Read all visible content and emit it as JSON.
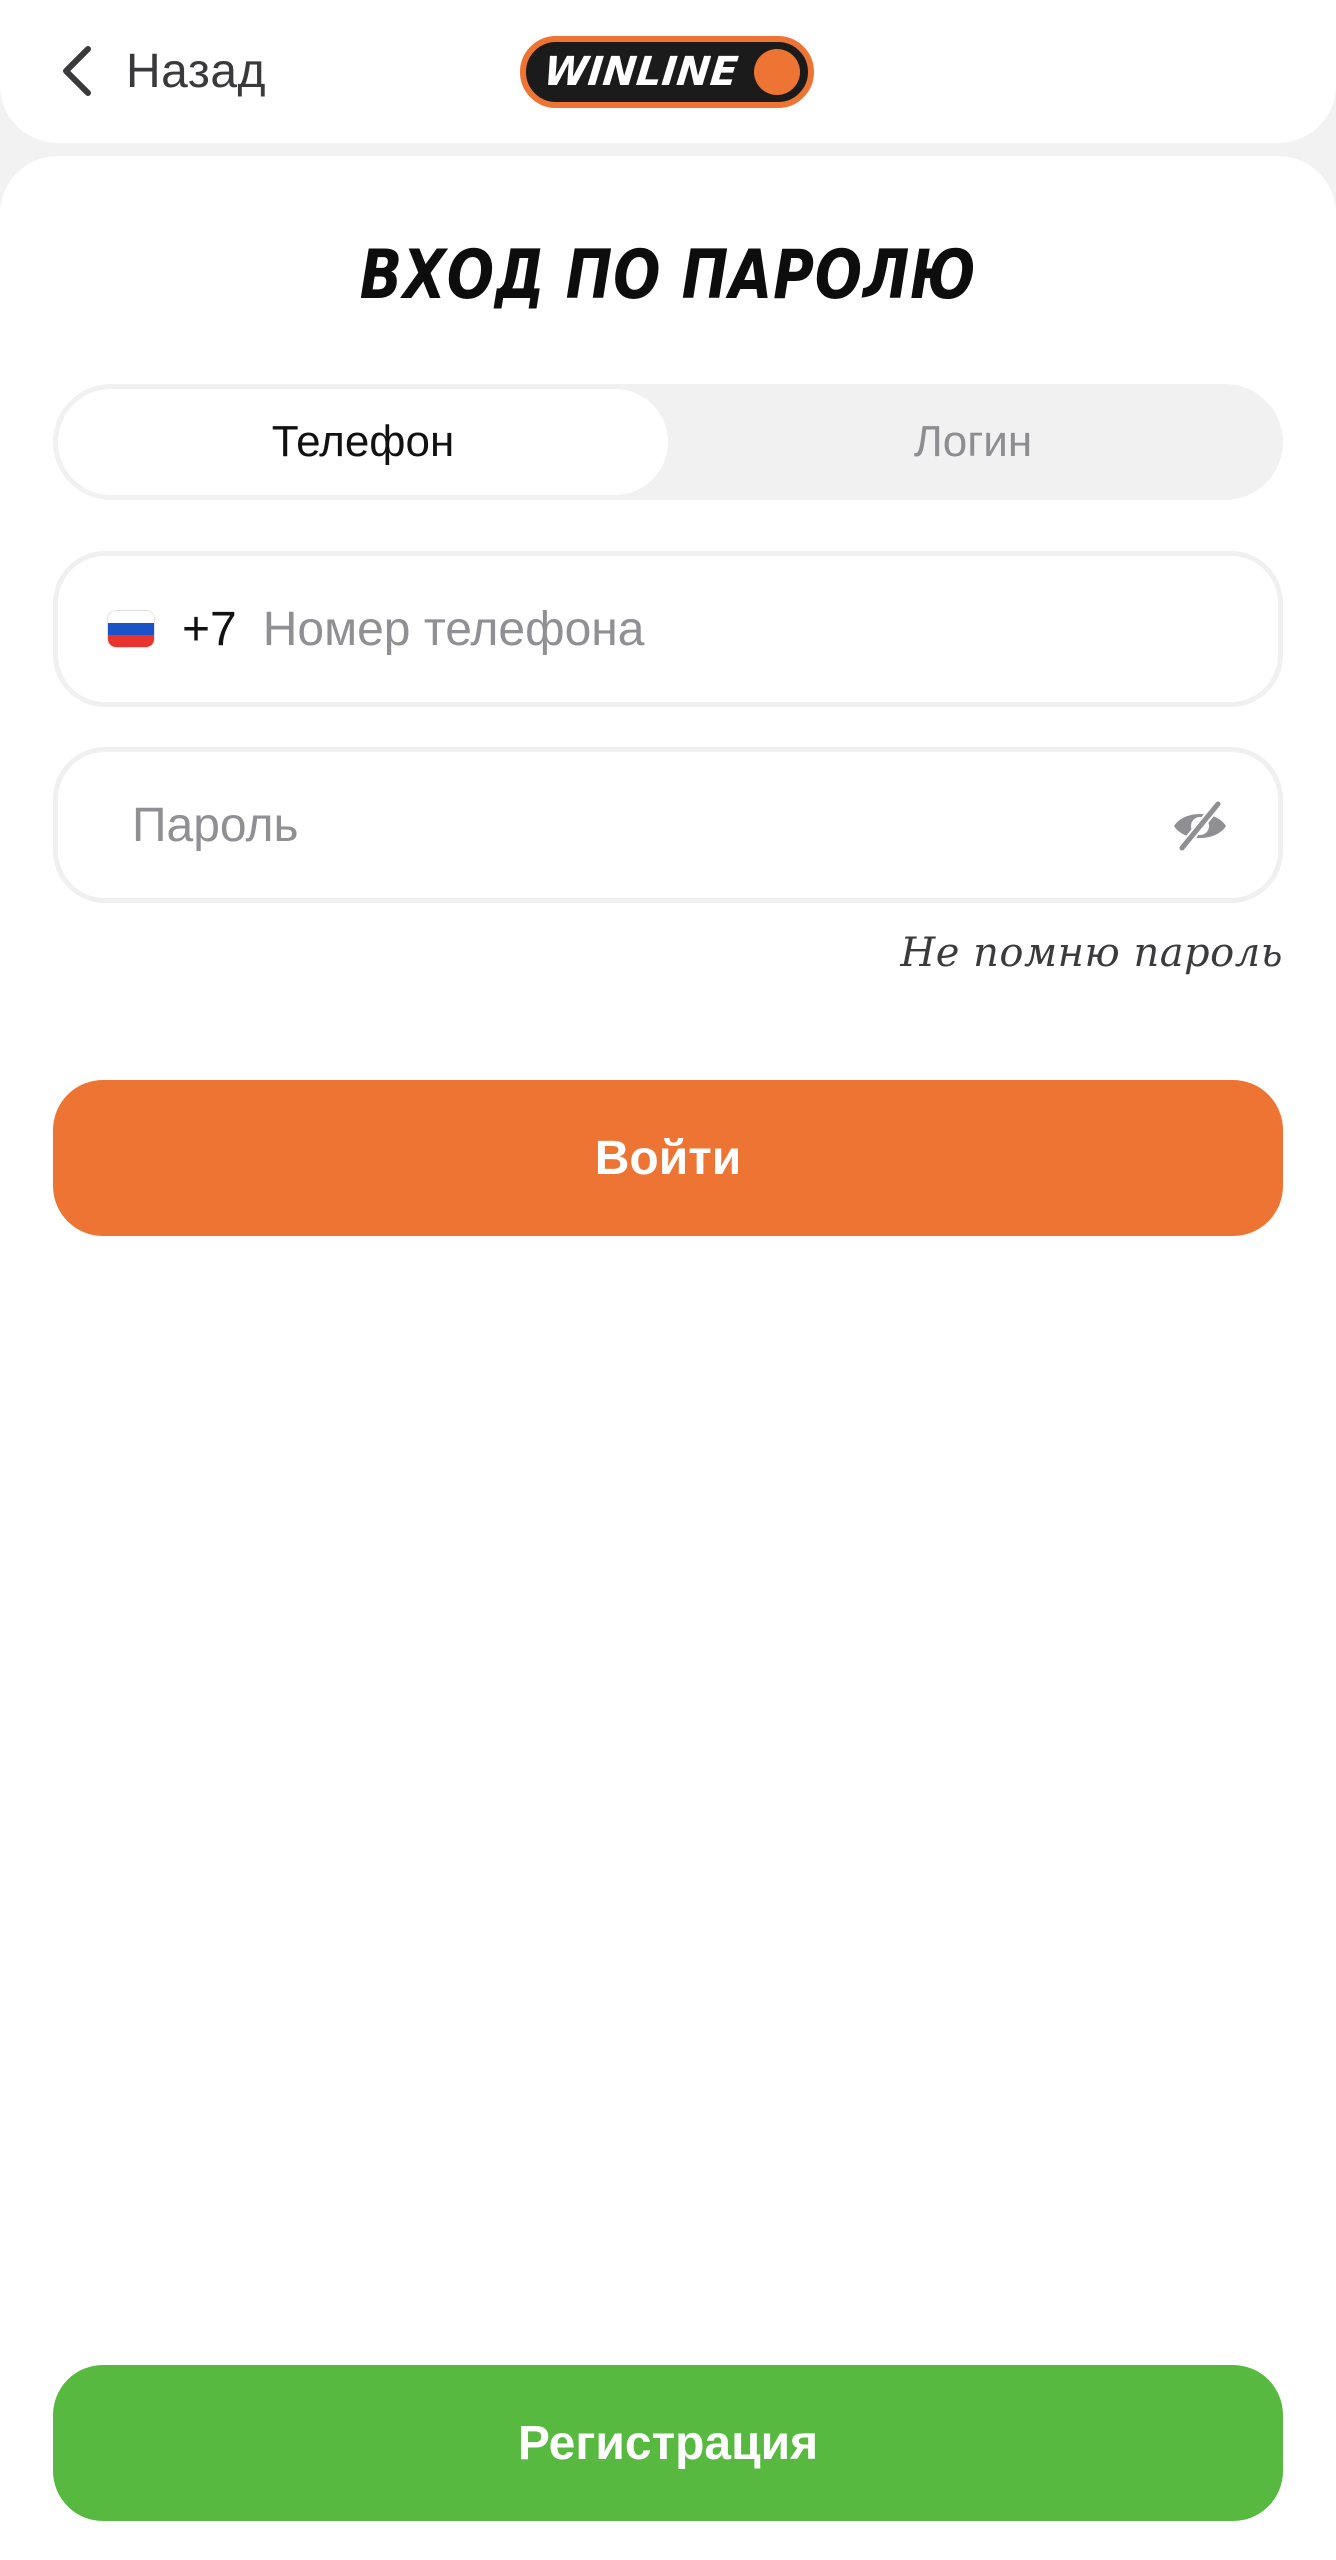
{
  "colors": {
    "accent_orange": "#ee7433",
    "register_green": "#58b941",
    "placeholder_gray": "#8f8f94"
  },
  "header": {
    "back_label": "Назад",
    "back_icon": "chevron-left-icon",
    "logo_text": "WINLINE"
  },
  "page": {
    "title": "ВХОД ПО ПАРОЛЮ"
  },
  "tabs": [
    {
      "label": "Телефон",
      "active": true
    },
    {
      "label": "Логин",
      "active": false
    }
  ],
  "phone": {
    "flag_icon": "russia-flag-icon",
    "country_code": "+7",
    "value": "",
    "placeholder": "Номер телефона"
  },
  "password": {
    "value": "",
    "placeholder": "Пароль",
    "toggle_icon": "eye-off-icon"
  },
  "forgot_label": "Не помню пароль",
  "login_button": "Войти",
  "register_button": "Регистрация"
}
